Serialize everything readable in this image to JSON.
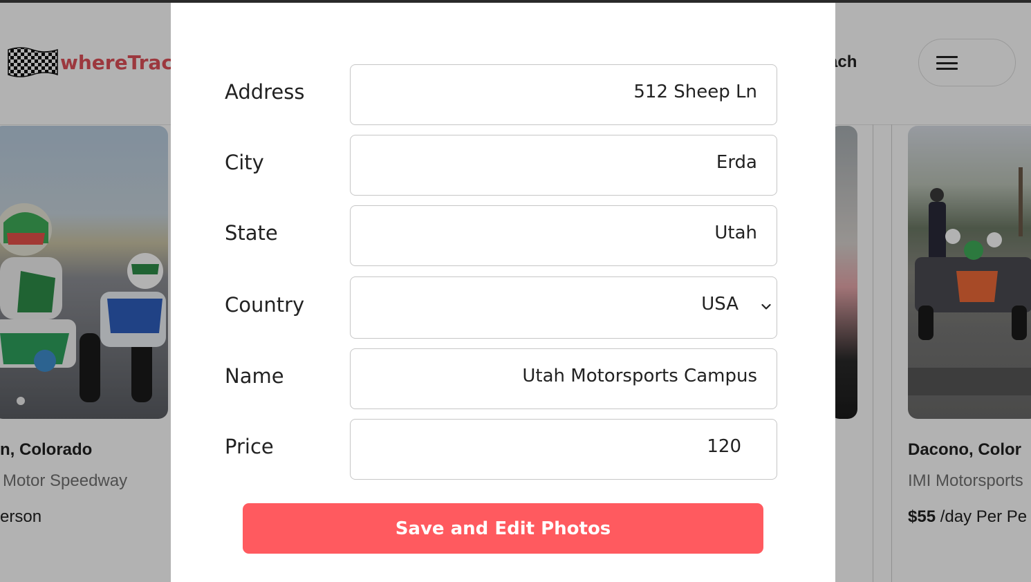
{
  "header": {
    "logo_text": "whereTrac",
    "nav_text": "ach"
  },
  "cards": [
    {
      "city": "n, Colorado",
      "name": "Motor Speedway",
      "price_text": "erson"
    },
    {
      "city": "Dacono, Color",
      "name": "IMI Motorsports",
      "price_value": "$55",
      "price_text": "/day Per Pe"
    }
  ],
  "modal": {
    "fields": [
      {
        "label": "Address",
        "value": "512 Sheep Ln"
      },
      {
        "label": "City",
        "value": "Erda"
      },
      {
        "label": "State",
        "value": "Utah"
      },
      {
        "label": "Country",
        "value": "USA"
      },
      {
        "label": "Name",
        "value": "Utah Motorsports Campus"
      },
      {
        "label": "Price",
        "value": "120"
      }
    ],
    "save_label": "Save and Edit Photos"
  },
  "colors": {
    "accent": "#ff5a5f",
    "logo": "#e0515a"
  }
}
